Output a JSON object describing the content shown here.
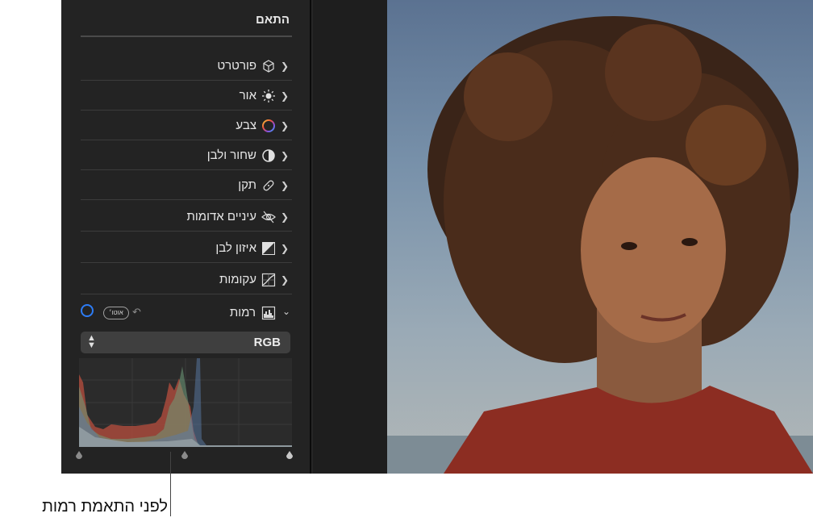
{
  "panel": {
    "title": "התאם",
    "rows": [
      {
        "label": "פורטרט",
        "icon": "cube-icon"
      },
      {
        "label": "אור",
        "icon": "sun-icon"
      },
      {
        "label": "צבע",
        "icon": "color-circle-icon"
      },
      {
        "label": "שחור ולבן",
        "icon": "half-circle-icon"
      },
      {
        "label": "תקן",
        "icon": "bandage-icon"
      },
      {
        "label": "עיניים אדומות",
        "icon": "eye-slash-icon"
      },
      {
        "label": "איזון לבן",
        "icon": "white-balance-icon"
      },
      {
        "label": "עקומות",
        "icon": "curves-icon"
      }
    ],
    "levels": {
      "label": "רמות",
      "icon": "levels-icon",
      "auto_label": "אוטו׳",
      "undo_icon": "undo-icon",
      "toggle_icon": "circle-toggle-icon"
    },
    "channel": {
      "value": "RGB",
      "icon": "up-down-arrows-icon"
    }
  },
  "caption": {
    "text": "לפני התאמת רמות"
  },
  "colors": {
    "accent": "#2d7cf5",
    "panel_bg": "#232323",
    "text": "#e6e6e6"
  }
}
